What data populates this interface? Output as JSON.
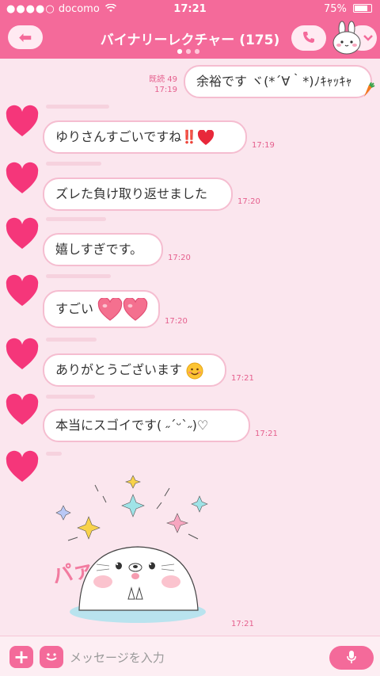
{
  "status_bar": {
    "signal": "●●●●○",
    "carrier": "docomo",
    "wifi_icon": "wifi-icon",
    "time": "17:21",
    "battery_percent": "75%",
    "battery_level": 0.75
  },
  "header": {
    "back_label": "⬅",
    "title": "バイナリーレクチャー (175)",
    "call_icon": "phone-icon",
    "menu_icon": "chevron-down-icon",
    "theme_color": "#f46a9a",
    "pager": {
      "total": 3,
      "active": 1
    }
  },
  "messages": [
    {
      "sender": "me",
      "text": "余裕です ヾ(*´∀｀*)ﾉｷｬｯｷｬ",
      "read": "既読 49",
      "time": "17:19"
    },
    {
      "sender": "other",
      "text": "ゆりさんすごいですね",
      "emoji": "‼️",
      "time": "17:19"
    },
    {
      "sender": "other",
      "text": "ズレた負け取り返せました",
      "time": "17:20"
    },
    {
      "sender": "other",
      "text": "嬉しすぎです。",
      "time": "17:20"
    },
    {
      "sender": "other",
      "text": "すごい",
      "time": "17:20"
    },
    {
      "sender": "other",
      "text": "ありがとうございます",
      "time": "17:21"
    },
    {
      "sender": "other",
      "text": "本当にスゴイです( ˶ˊᵕˋ˶)♡",
      "time": "17:21"
    },
    {
      "sender": "other",
      "type": "sticker",
      "sticker": "seal-sticker",
      "text": "パァァ",
      "time": "17:21"
    }
  ],
  "input_bar": {
    "plus_label": "+",
    "emoji_icon": "smile-icon",
    "placeholder": "メッセージを入力",
    "mic_icon": "mic-icon"
  }
}
